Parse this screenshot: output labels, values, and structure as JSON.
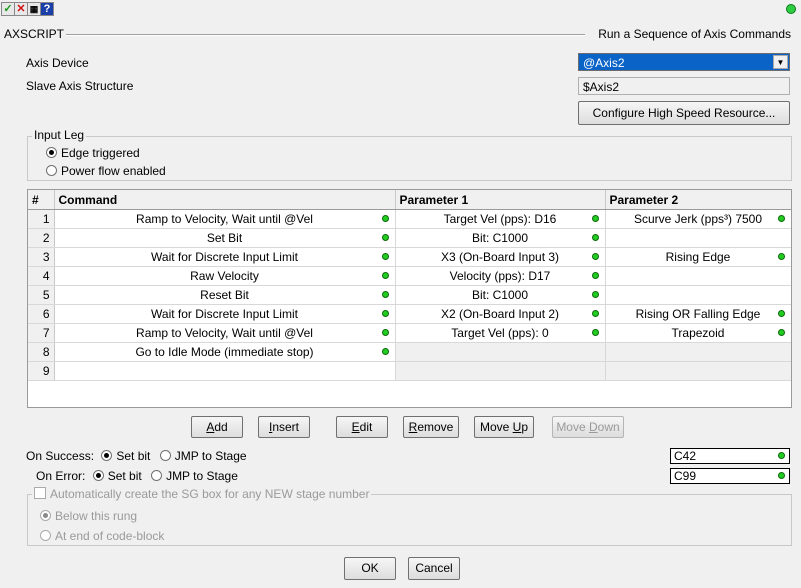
{
  "toolbar": {
    "icons": [
      "check-icon",
      "close-icon",
      "screenshot-icon",
      "help-icon"
    ]
  },
  "header": {
    "left": "AXSCRIPT",
    "right": "Run a Sequence of Axis Commands"
  },
  "axis_device": {
    "label": "Axis Device",
    "value": "@Axis2"
  },
  "slave_axis": {
    "label": "Slave Axis Structure",
    "value": "$Axis2"
  },
  "configure_button": "Configure High Speed Resource...",
  "input_leg": {
    "title": "Input Leg",
    "options": [
      "Edge triggered",
      "Power flow enabled"
    ],
    "selected": 0
  },
  "table": {
    "headers": [
      "#",
      "Command",
      "Parameter 1",
      "Parameter 2"
    ],
    "rows": [
      {
        "n": "1",
        "cmd": "Ramp to Velocity, Wait until @Vel",
        "p1": "Target Vel (pps): D16",
        "p2": "Scurve Jerk (pps³) 7500"
      },
      {
        "n": "2",
        "cmd": "Set Bit",
        "p1": "Bit: C1000",
        "p2": ""
      },
      {
        "n": "3",
        "cmd": "Wait for Discrete Input Limit",
        "p1": "X3 (On-Board Input 3)",
        "p2": "Rising Edge"
      },
      {
        "n": "4",
        "cmd": "Raw Velocity",
        "p1": "Velocity (pps): D17",
        "p2": ""
      },
      {
        "n": "5",
        "cmd": "Reset Bit",
        "p1": "Bit: C1000",
        "p2": ""
      },
      {
        "n": "6",
        "cmd": "Wait for Discrete Input Limit",
        "p1": "X2 (On-Board Input 2)",
        "p2": "Rising OR Falling Edge"
      },
      {
        "n": "7",
        "cmd": "Ramp to Velocity, Wait until @Vel",
        "p1": "Target Vel (pps): 0",
        "p2": "Trapezoid"
      },
      {
        "n": "8",
        "cmd": "Go to Idle Mode (immediate stop)",
        "p1": "",
        "p2": ""
      },
      {
        "n": "9",
        "cmd": "",
        "p1": "",
        "p2": ""
      }
    ]
  },
  "buttons": {
    "add": {
      "pre": "",
      "u": "A",
      "post": "dd"
    },
    "insert": {
      "pre": "",
      "u": "I",
      "post": "nsert"
    },
    "edit": {
      "pre": "",
      "u": "E",
      "post": "dit"
    },
    "remove": {
      "pre": "",
      "u": "R",
      "post": "emove"
    },
    "moveup": {
      "pre": "Move ",
      "u": "U",
      "post": "p"
    },
    "movedown": {
      "pre": "Move ",
      "u": "D",
      "post": "own"
    }
  },
  "on_success": {
    "label": "On Success:",
    "opt1": "Set bit",
    "opt2": "JMP to Stage",
    "value": "C42"
  },
  "on_error": {
    "label": "On Error:",
    "opt1": "Set bit",
    "opt2": "JMP to Stage",
    "value": "C99"
  },
  "auto_create": {
    "label": "Automatically create the SG box for any NEW stage number",
    "options": [
      "Below this rung",
      "At end of code-block"
    ]
  },
  "ok": "OK",
  "cancel": "Cancel",
  "colors": {
    "accent": "#0a64c8",
    "ok_dot": "#22cc22"
  }
}
